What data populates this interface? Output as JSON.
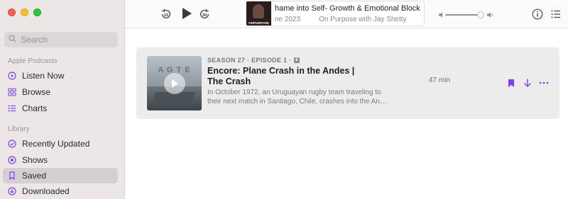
{
  "window": {
    "traffic_lights": [
      "close",
      "minimize",
      "zoom"
    ]
  },
  "sidebar": {
    "search": {
      "placeholder": "Search",
      "icon": "magnifyingglass-icon"
    },
    "sections": [
      {
        "title": "Apple Podcasts",
        "items": [
          {
            "label": "Listen Now",
            "icon": "play-circle-icon",
            "selected": false
          },
          {
            "label": "Browse",
            "icon": "grid-icon",
            "selected": false
          },
          {
            "label": "Charts",
            "icon": "list-icon",
            "selected": false
          }
        ]
      },
      {
        "title": "Library",
        "items": [
          {
            "label": "Recently Updated",
            "icon": "clock-icon",
            "selected": false
          },
          {
            "label": "Shows",
            "icon": "podcast-icon",
            "selected": false
          },
          {
            "label": "Saved",
            "icon": "bookmark-icon",
            "selected": true
          },
          {
            "label": "Downloaded",
            "icon": "download-icon",
            "selected": false
          }
        ]
      }
    ]
  },
  "player": {
    "skip_back": "15",
    "skip_forward": "30",
    "now_playing": {
      "title": "hame into Self- Growth & Emotional Block",
      "date": "ne 2023",
      "show": "On Purpose with Jay Shetty",
      "artwork_label": "ONPURPOSE"
    },
    "volume": 0.8
  },
  "episode": {
    "season_episode": "SEASON 27 · EPISODE 1 ·",
    "explicit_badge": "E",
    "title": "Encore: Plane Crash in the Andes | The Crash",
    "description": "In October 1972, an Uruguayan rugby team traveling to their next match in Santiago, Chile, crashes into the An…",
    "duration": "47 min",
    "artwork_text": "A G  T   E"
  },
  "colors": {
    "accent": "#7b3ff2",
    "sidebar_bg": "#ece6e6",
    "card_bg": "#ececec"
  }
}
